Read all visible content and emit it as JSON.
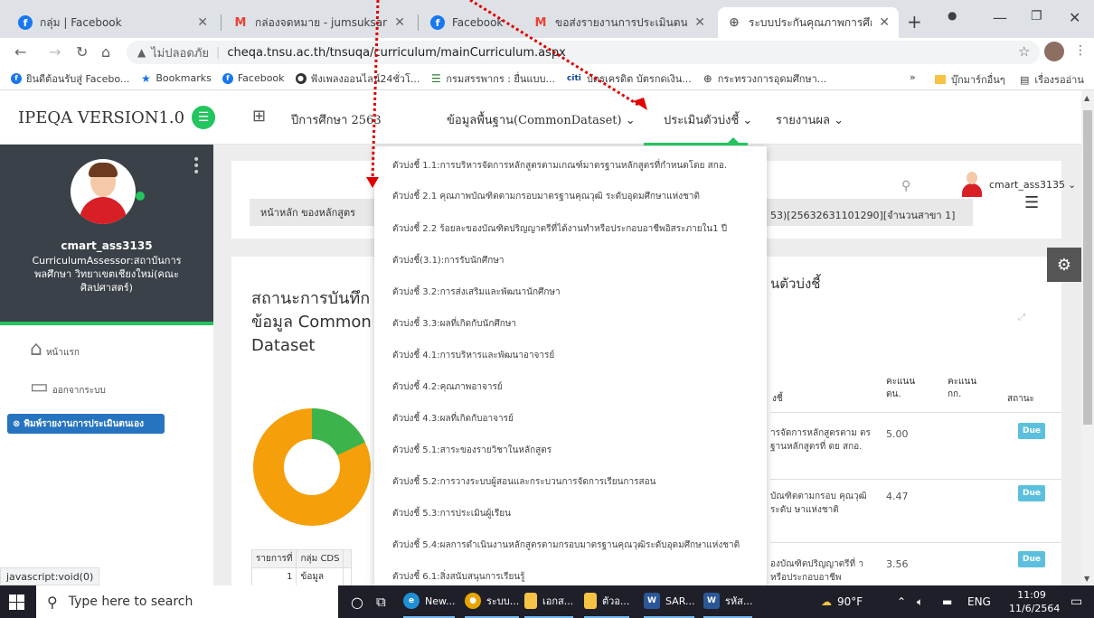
{
  "browser": {
    "tabs": [
      {
        "title": "กลุ่ม | Facebook",
        "favicon": "facebook-icon",
        "color": "#1877f2"
      },
      {
        "title": "กล่องจดหมาย - jumsuksane",
        "favicon": "gmail-icon",
        "color": "#ea4335"
      },
      {
        "title": "Facebook",
        "favicon": "facebook-icon",
        "color": "#1877f2"
      },
      {
        "title": "ขอส่งรายงานการประเมินตนเอง",
        "favicon": "gmail-icon",
        "color": "#ea4335"
      },
      {
        "title": "ระบบประกันคุณภาพการศึกษา",
        "favicon": "globe-icon",
        "color": "#5f6368"
      }
    ],
    "address": {
      "security": "ไม่ปลอดภัย",
      "url": "cheqa.tnsu.ac.th/tnsuqa/curriculum/mainCurriculum.aspx"
    },
    "bookmarks": [
      {
        "label": "ยินดีต้อนรับสู่ Facebo...",
        "color": "#1877f2"
      },
      {
        "label": "Bookmarks",
        "color": "#1a73e8"
      },
      {
        "label": "Facebook",
        "color": "#1877f2"
      },
      {
        "label": "ฟังเพลงออนไลน์24ชั่วโ...",
        "color": "#333333"
      },
      {
        "label": "กรมสรรพากร : ยื่นแบบ...",
        "color": "#2e7d32"
      },
      {
        "label": "บัตรเครดิต บัตรกดเงิน...",
        "color": "#0d47a1"
      },
      {
        "label": "กระทรวงการอุดมศึกษา...",
        "color": "#5f6368"
      }
    ],
    "bookmarks_overflow": "»",
    "other_bookmarks": "บุ๊กมาร์กอื่นๆ",
    "reading_list": "เรื่องรออ่าน",
    "status_url": "javascript:void(0)"
  },
  "app": {
    "brand": "IPEQA VERSION1.0",
    "nav": {
      "year_label": "ปีการศึกษา 2563",
      "common_dataset": "ข้อมูลพื้นฐาน(CommonDataset)",
      "indicators": "ประเมินตัวบ่งชี้",
      "reports": "รายงานผล"
    },
    "accent": "#22c55e",
    "user": {
      "name": "cmart_ass3135",
      "role": "CurriculumAssessor:สถาบันการพลศึกษา วิทยาเขตเชียงใหม่(คณะศิลปศาสตร์)",
      "chip": "cmart_ass3135"
    },
    "sidebar": {
      "home": "หน้าแรก",
      "logout": "ออกจากระบบ",
      "print_button": "พิมพ์รายงานการประเมินตนเอง"
    },
    "breadcrumb": {
      "left": "หน้าหลัก ของหลักสูตร",
      "right": "53)[25632631101290][จำนวนสาขา 1]"
    },
    "status_title": "สถานะการบันทึก ข้อมูล Common Dataset",
    "indicator_title": "นตัวบ่งชี้",
    "donut": {
      "green_fraction": 0.18,
      "green": "#3cb44b",
      "orange": "#f5a00b"
    },
    "cds_table": {
      "headers": [
        "รายการที่",
        "กลุ่ม CDS"
      ],
      "rows": [
        [
          "1",
          "ข้อมูล"
        ]
      ]
    },
    "score_table": {
      "headers": [
        "งชี้",
        "คะแนน ตน.",
        "คะแนน กก.",
        "สถานะ"
      ],
      "rows": [
        {
          "name": "ารจัดการหลักสูตรตาม ตรฐานหลักสูตรที่ ดย สกอ.",
          "score": "5.00",
          "status": "Due"
        },
        {
          "name": "บัณฑิตตามกรอบ คุณวุฒิ ระดับ ษาแห่งชาติ",
          "score": "4.47",
          "status": "Due"
        },
        {
          "name": "องบัณฑิตปริญญาตรีที่ าหรือประกอบอาชีพ",
          "score": "3.56",
          "status": "Due"
        }
      ]
    },
    "dropdown_items": [
      "ตัวบ่งชี้ 1.1:การบริหารจัดการหลักสูตรตามเกณฑ์มาตรฐานหลักสูตรที่กำหนดโดย สกอ.",
      "ตัวบ่งชี้ 2.1 คุณภาพบัณฑิตตามกรอบมาตรฐานคุณวุฒิ ระดับอุดมศึกษาแห่งชาติ",
      "ตัวบ่งชี้ 2.2 ร้อยละของบัณฑิตปริญญาตรีที่ได้งานทำหรือประกอบอาชีพอิสระภายใน1 ปี",
      "ตัวบ่งชี้(3.1):การรับนักศึกษา",
      "ตัวบ่งชี้ 3.2:การส่งเสริมและพัฒนานักศึกษา",
      "ตัวบ่งชี้ 3.3:ผลที่เกิดกับนักศึกษา",
      "ตัวบ่งชี้ 4.1:การบริหารและพัฒนาอาจารย์",
      "ตัวบ่งชี้ 4.2:คุณภาพอาจารย์",
      "ตัวบ่งชี้ 4.3:ผลที่เกิดกับอาจารย์",
      "ตัวบ่งชี้ 5.1:สาระของรายวิชาในหลักสูตร",
      "ตัวบ่งชี้ 5.2:การวางระบบผู้สอนและกระบวนการจัดการเรียนการสอน",
      "ตัวบ่งชี้ 5.3:การประเมินผู้เรียน",
      "ตัวบ่งชี้ 5.4:ผลการดำเนินงานหลักสูตรตามกรอบมาตรฐานคุณวุฒิระดับอุดมศึกษาแห่งชาติ",
      "ตัวบ่งชี้ 6.1:สิ่งสนับสนุนการเรียนรู้"
    ]
  },
  "taskbar": {
    "search_placeholder": "Type here to search",
    "items": [
      {
        "label": "New...",
        "icon": "edge-icon",
        "color": "#1f8fd6"
      },
      {
        "label": "ระบบ...",
        "icon": "chrome-icon",
        "color": "#e8a400"
      },
      {
        "label": "เอกส...",
        "icon": "folder-icon",
        "color": "#f6c344"
      },
      {
        "label": "ตัวอ...",
        "icon": "folder-icon",
        "color": "#f6c344"
      },
      {
        "label": "SAR...",
        "icon": "word-icon",
        "color": "#2b5797"
      },
      {
        "label": "รหัส...",
        "icon": "word-icon",
        "color": "#2b5797"
      }
    ],
    "weather": "90°F",
    "lang": "ENG",
    "time": "11:09",
    "date": "11/6/2564"
  }
}
